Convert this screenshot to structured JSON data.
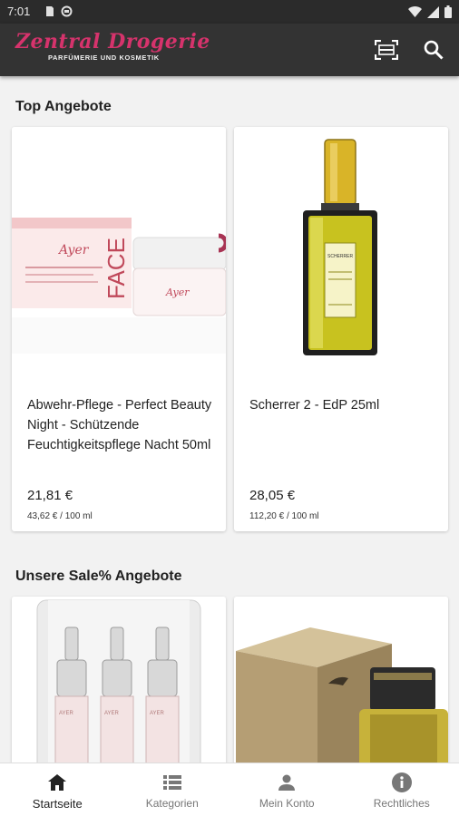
{
  "status": {
    "time": "7:01"
  },
  "brand": {
    "name": "Zentral Drogerie",
    "subtitle": "PARFÜMERIE UND KOSMETIK"
  },
  "app_bar": {
    "scan_icon": "barcode-scan-icon",
    "search_icon": "search-icon"
  },
  "sections": [
    {
      "title": "Top Angebote",
      "products": [
        {
          "name": "Abwehr-Pflege - Perfect Beauty Night - Schützende Feuchtigkeitspflege Nacht 50ml",
          "price": "21,81 €",
          "unit_price": "43,62 € / 100 ml",
          "image_label": "FACE",
          "image_brand": "Ayer"
        },
        {
          "name": "Scherrer 2 - EdP 25ml",
          "price": "28,05 €",
          "unit_price": "112,20 € / 100 ml",
          "image_label": "SCHERRER"
        }
      ]
    },
    {
      "title": "Unsere Sale% Angebote",
      "products": [
        {
          "image_label": "AYER"
        },
        {
          "image_label": ""
        }
      ]
    }
  ],
  "bottom_nav": [
    {
      "label": "Startseite",
      "icon": "home-icon",
      "active": true
    },
    {
      "label": "Kategorien",
      "icon": "list-icon",
      "active": false
    },
    {
      "label": "Mein Konto",
      "icon": "person-icon",
      "active": false
    },
    {
      "label": "Rechtliches",
      "icon": "info-icon",
      "active": false
    }
  ]
}
